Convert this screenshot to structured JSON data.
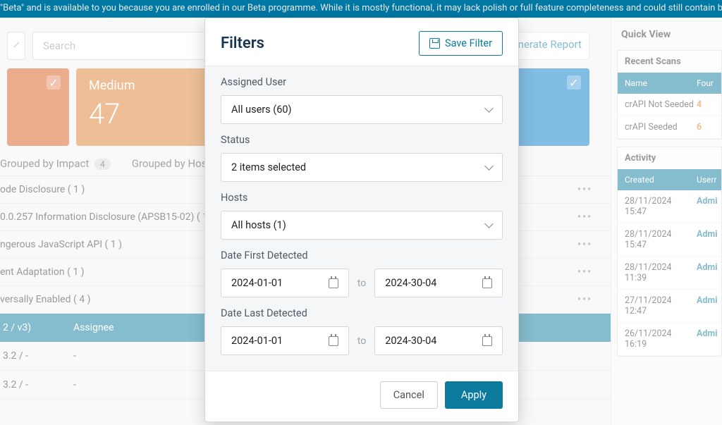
{
  "banner_text": "\"Beta\" and is available to you because you are enrolled in our Beta programme. While it is mostly functional, it may lack polish or full feature completeness and could still contain bugs.",
  "toolbar": {
    "search_placeholder": "Search",
    "generate_report_label": "Generate Report"
  },
  "cards": {
    "medium_label": "Medium",
    "medium_count": "47"
  },
  "tabs": {
    "impact_label": "Grouped by Impact",
    "impact_count": "4",
    "host_label": "Grouped by Hos"
  },
  "findings": [
    "ode Disclosure ( 1 )",
    "0.0.257 Information Disclosure (APSB15-02) ( 1 )",
    "ngerous JavaScript API ( 1 )",
    "ent Adaptation ( 1 )",
    "versally Enabled ( 4 )"
  ],
  "findings_table": {
    "header1": "2 / v3)",
    "header2": "Assignee",
    "rows": [
      {
        "c1": "3.2 / -",
        "c2": "-"
      },
      {
        "c1": "3.2 / -",
        "c2": "-"
      }
    ]
  },
  "quick_view": {
    "title": "Quick View",
    "recent_scans": {
      "title": "Recent Scans",
      "h1": "Name",
      "h2": "Four",
      "rows": [
        {
          "name": "crAPI Not Seeded",
          "val": "4"
        },
        {
          "name": "crAPI Seeded",
          "val": "6"
        }
      ]
    },
    "activity": {
      "title": "Activity",
      "h1": "Created",
      "h2": "Userr",
      "rows": [
        {
          "t": "28/11/2024 15:47",
          "u": "Admi"
        },
        {
          "t": "28/11/2024 15:47",
          "u": "Admi"
        },
        {
          "t": "28/11/2024 11:39",
          "u": "Admi"
        },
        {
          "t": "27/11/2024 12:47",
          "u": "Admi"
        },
        {
          "t": "26/11/2024 16:19",
          "u": "Admi"
        }
      ]
    }
  },
  "modal": {
    "title": "Filters",
    "save_filter_label": "Save Filter",
    "assigned_user_label": "Assigned User",
    "assigned_user_value": "All users (60)",
    "status_label": "Status",
    "status_value": "2 items selected",
    "hosts_label": "Hosts",
    "hosts_value": "All hosts (1)",
    "date_first_label": "Date First Detected",
    "date_first_from": "2024-01-01",
    "date_first_to_value": "2024-30-04",
    "date_last_label": "Date Last Detected",
    "date_last_from": "2024-01-01",
    "date_last_to_value": "2024-30-04",
    "date_sep": "to",
    "cancel_label": "Cancel",
    "apply_label": "Apply"
  }
}
